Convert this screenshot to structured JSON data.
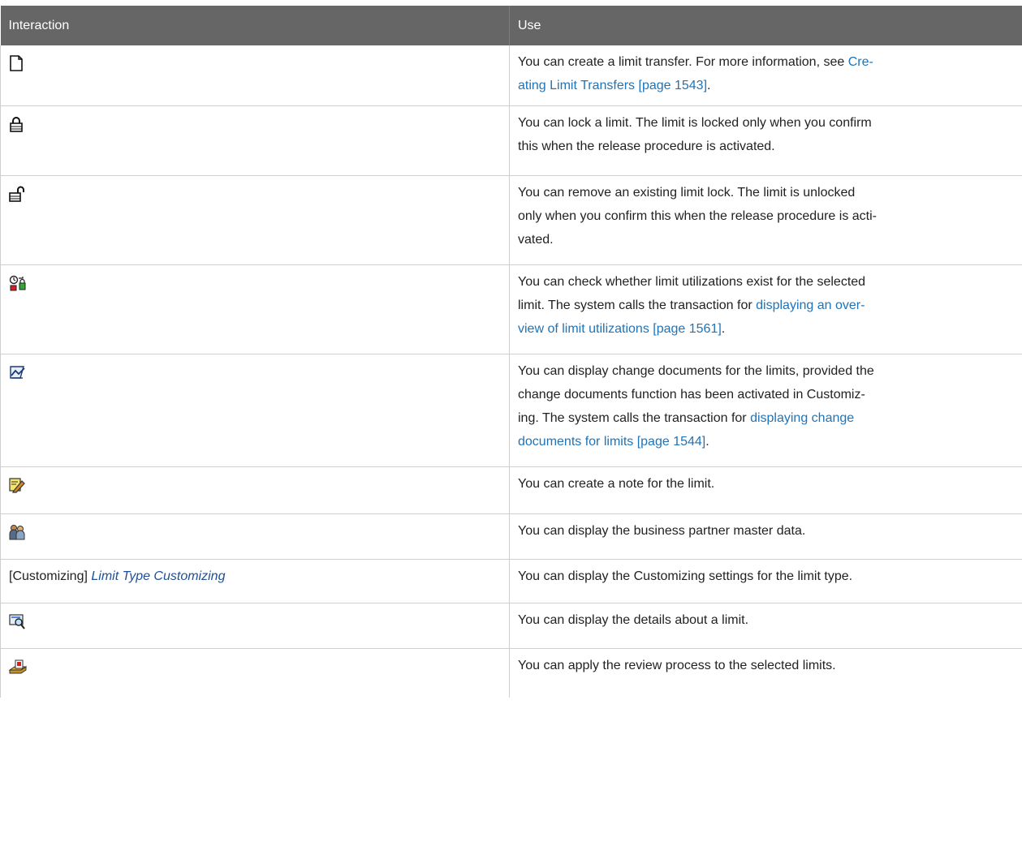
{
  "header": {
    "col1": "Interaction",
    "col2": "Use"
  },
  "rows": [
    {
      "icon": "create-document-icon",
      "parts": [
        "You can create a limit transfer. For more information, see ",
        "Cre-",
        "ating Limit Transfers [page 1543]",
        "."
      ]
    },
    {
      "icon": "lock-icon",
      "lines": [
        "You can lock a limit. The limit is locked only when you confirm",
        "this when the release procedure is activated."
      ]
    },
    {
      "icon": "unlock-icon",
      "lines": [
        "You can remove an existing limit lock. The limit is unlocked",
        "only when you confirm this when the release procedure is acti-",
        "vated."
      ]
    },
    {
      "icon": "utilization-check-icon",
      "parts": [
        "You can check whether limit utilizations exist for the selected",
        "limit. The system calls the transaction for ",
        "displaying an over-",
        "view of limit utilizations [page 1561]",
        "."
      ]
    },
    {
      "icon": "change-documents-icon",
      "parts": [
        "You can display change documents for the limits, provided the",
        "change documents function has been activated in Customiz-",
        "ing. The system calls the transaction for ",
        "displaying change",
        "documents for limits [page 1544]",
        "."
      ]
    },
    {
      "icon": "create-note-icon",
      "lines": [
        "You can create a note for the limit."
      ]
    },
    {
      "icon": "business-partner-icon",
      "lines": [
        "You can display the business partner master data."
      ]
    },
    {
      "interaction_prefix": "[Customizing] ",
      "interaction_link": "Limit Type Customizing",
      "lines": [
        "You can display the Customizing settings for the limit type."
      ]
    },
    {
      "icon": "details-icon",
      "lines": [
        "You can display the details about a limit."
      ]
    },
    {
      "icon": "review-process-icon",
      "lines": [
        "You can apply the review process to the selected limits."
      ]
    }
  ]
}
